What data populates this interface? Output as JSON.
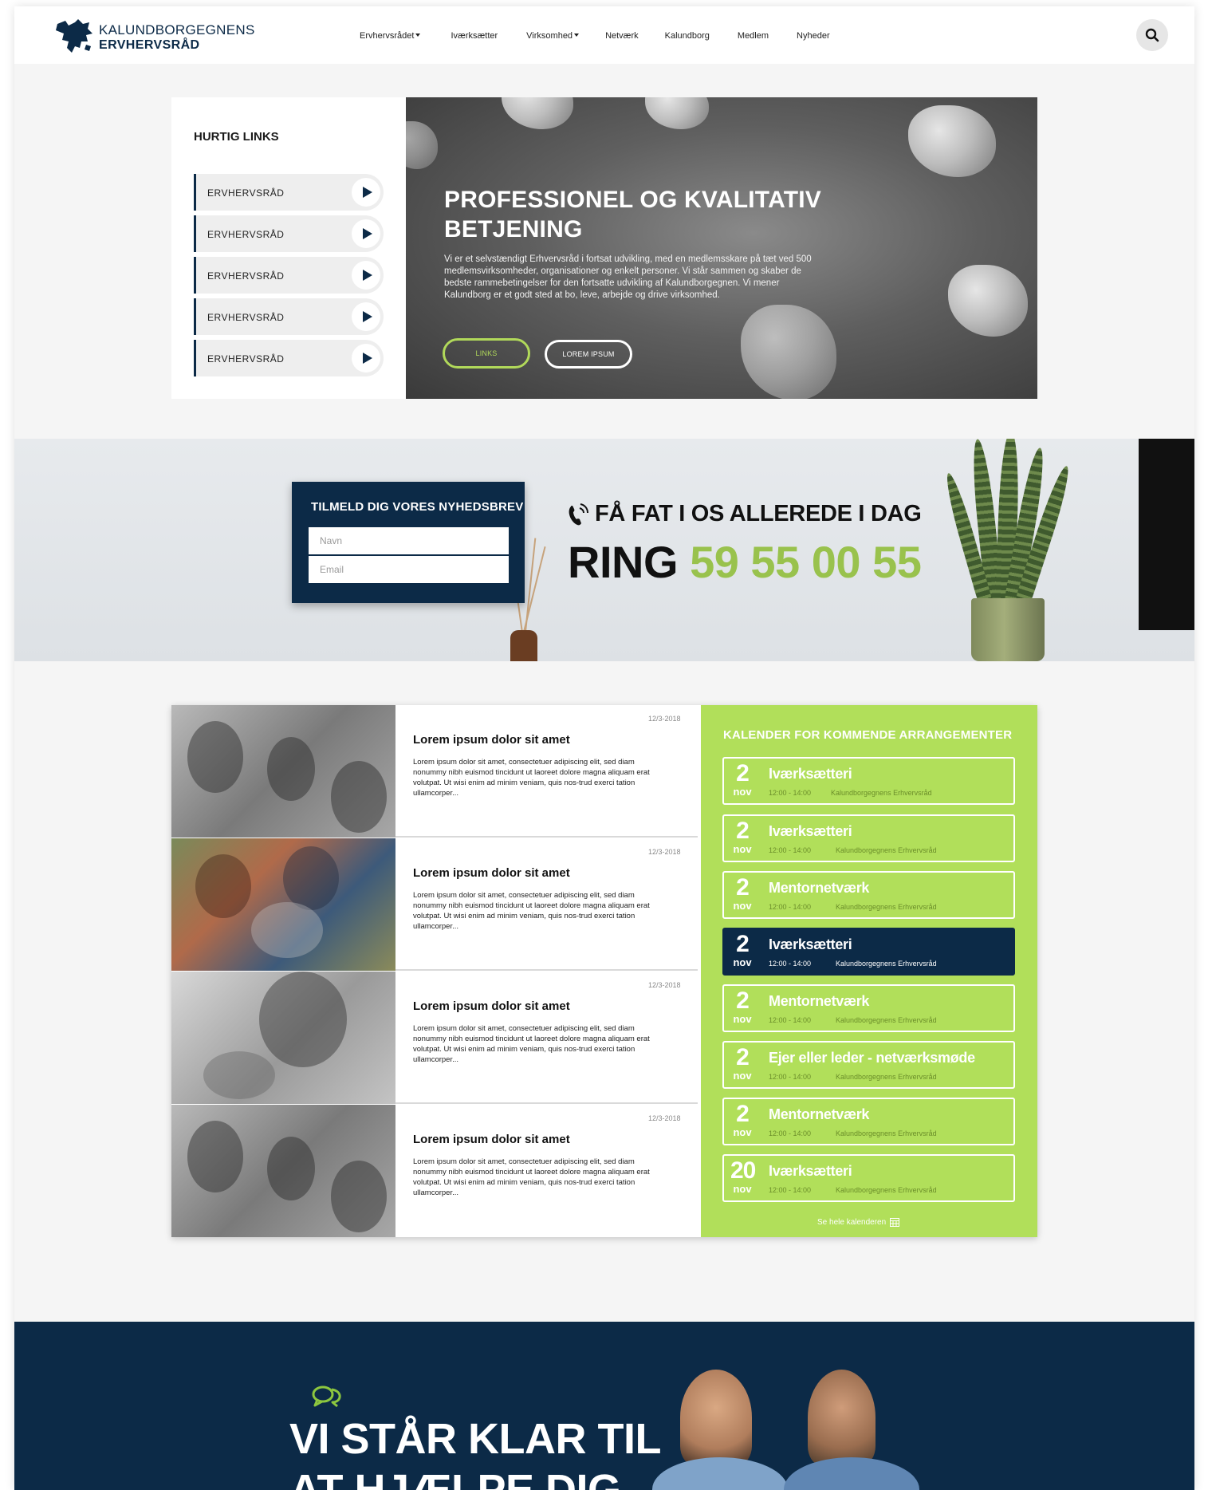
{
  "header": {
    "logo_line1": "KALUNDBORGEGNENS",
    "logo_line2": "ERVHERVSRÅD",
    "nav": [
      {
        "label": "Ervhervsrådet",
        "dropdown": true
      },
      {
        "label": "Iværksætter",
        "dropdown": false
      },
      {
        "label": "Virksomhed",
        "dropdown": true
      },
      {
        "label": "Netværk",
        "dropdown": false
      },
      {
        "label": "Kalundborg",
        "dropdown": false
      },
      {
        "label": "Medlem",
        "dropdown": false
      },
      {
        "label": "Nyheder",
        "dropdown": false
      }
    ]
  },
  "quick_links": {
    "title": "HURTIG LINKS",
    "items": [
      "ERVHERVSRÅD",
      "ERVHERVSRÅD",
      "ERVHERVSRÅD",
      "ERVHERVSRÅD",
      "ERVHERVSRÅD"
    ]
  },
  "hero": {
    "title": "PROFESSIONEL OG KVALITATIV BETJENING",
    "text": "Vi er et selvstændigt Erhvervsråd i fortsat udvikling, med en medlemsskare på tæt ved 500 medlemsvirksomheder, organisationer og enkelt personer. Vi står sammen og skaber de bedste rammebetingelser for den fortsatte udvikling af Kalundborgegnen. Vi mener Kalundborg er et godt sted at bo, leve, arbejde og drive virksomhed.",
    "button1": "LINKS",
    "button2": "LOREM IPSUM"
  },
  "newsletter": {
    "title": "TILMELD DIG VORES NYHEDSBREV",
    "name_placeholder": "Navn",
    "email_placeholder": "Email"
  },
  "cta": {
    "line1": "FÅ FAT I OS ALLEREDE I DAG",
    "ring_label": "RING",
    "phone": "59 55 00 55"
  },
  "news": [
    {
      "date": "12/3-2018",
      "title": "Lorem ipsum dolor sit amet",
      "text": "Lorem ipsum dolor sit amet, consectetuer adipiscing elit, sed diam nonummy nibh euismod tincidunt ut laoreet dolore magna aliquam erat volutpat. Ut wisi enim ad minim veniam, quis nos-trud exerci tation ullamcorper..."
    },
    {
      "date": "12/3-2018",
      "title": "Lorem ipsum dolor sit amet",
      "text": "Lorem ipsum dolor sit amet, consectetuer adipiscing elit, sed diam nonummy nibh euismod tincidunt ut laoreet dolore magna aliquam erat volutpat. Ut wisi enim ad minim veniam, quis nos-trud exerci tation ullamcorper..."
    },
    {
      "date": "12/3-2018",
      "title": "Lorem ipsum dolor sit amet",
      "text": "Lorem ipsum dolor sit amet, consectetuer adipiscing elit, sed diam nonummy nibh euismod tincidunt ut laoreet dolore magna aliquam erat volutpat. Ut wisi enim ad minim veniam, quis nos-trud exerci tation ullamcorper..."
    },
    {
      "date": "12/3-2018",
      "title": "Lorem ipsum dolor sit amet",
      "text": "Lorem ipsum dolor sit amet, consectetuer adipiscing elit, sed diam nonummy nibh euismod tincidunt ut laoreet dolore magna aliquam erat volutpat. Ut wisi enim ad minim veniam, quis nos-trud exerci tation ullamcorper..."
    }
  ],
  "calendar": {
    "title": "KALENDER FOR KOMMENDE ARRANGEMENTER",
    "events": [
      {
        "day": "2",
        "month": "nov",
        "name": "Iværksætteri",
        "time": "12:00 - 14:00",
        "org": "Kalundborgegnens Erhvervsråd",
        "active": false
      },
      {
        "day": "2",
        "month": "nov",
        "name": "Iværksætteri",
        "time": "12:00 - 14:00",
        "org": "Kalundborgegnens Erhvervsråd",
        "active": false
      },
      {
        "day": "2",
        "month": "nov",
        "name": "Mentornetværk",
        "time": "12:00 - 14:00",
        "org": "Kalundborgegnens Erhvervsråd",
        "active": false
      },
      {
        "day": "2",
        "month": "nov",
        "name": "Iværksætteri",
        "time": "12:00 - 14:00",
        "org": "Kalundborgegnens Erhvervsråd",
        "active": true
      },
      {
        "day": "2",
        "month": "nov",
        "name": "Mentornetværk",
        "time": "12:00 - 14:00",
        "org": "Kalundborgegnens Erhvervsråd",
        "active": false
      },
      {
        "day": "2",
        "month": "nov",
        "name": "Ejer eller leder - netværksmøde",
        "time": "12:00 - 14:00",
        "org": "Kalundborgegnens Erhvervsråd",
        "active": false
      },
      {
        "day": "2",
        "month": "nov",
        "name": "Mentornetværk",
        "time": "12:00 - 14:00",
        "org": "Kalundborgegnens Erhvervsråd",
        "active": false
      },
      {
        "day": "20",
        "month": "nov",
        "name": "Iværksætteri",
        "time": "12:00 - 14:00",
        "org": "Kalundborgegnens Erhvervsråd",
        "active": false
      }
    ],
    "see_all": "Se hele kalenderen"
  },
  "footer_cta": {
    "title": "VI STÅR KLAR TIL AT HJÆLPE DIG"
  },
  "colors": {
    "navy": "#0c2a47",
    "lime": "#b1df5a",
    "phone_green": "#99c24d"
  }
}
